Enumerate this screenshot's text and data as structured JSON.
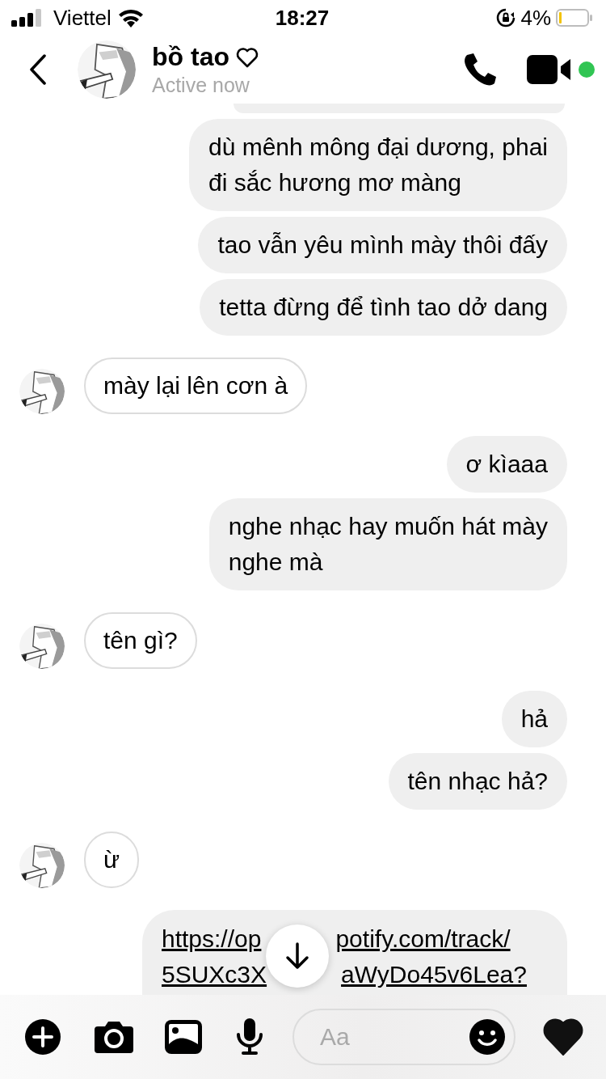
{
  "status_bar": {
    "carrier": "Viettel",
    "time": "18:27",
    "battery": "4%"
  },
  "header": {
    "name": "bồ tao",
    "status": "Active now"
  },
  "messages": [
    {
      "outgoing": true,
      "kind": "fragment"
    },
    {
      "outgoing": true,
      "kind": "text",
      "lines": [
        "dù mênh mông đại dương, phai",
        "đi sắc hương mơ màng"
      ]
    },
    {
      "outgoing": true,
      "kind": "text",
      "lines": [
        "tao vẫn yêu mình mày thôi đấy"
      ]
    },
    {
      "outgoing": true,
      "kind": "text",
      "lines": [
        "tetta đừng để tình tao dở dang"
      ]
    },
    {
      "outgoing": false,
      "kind": "text",
      "lines": [
        "mày lại lên cơn à"
      ]
    },
    {
      "outgoing": true,
      "kind": "text",
      "lines": [
        "ơ kìaaa"
      ]
    },
    {
      "outgoing": true,
      "kind": "text",
      "lines": [
        "nghe nhạc hay muốn hát mày",
        "nghe mà"
      ]
    },
    {
      "outgoing": false,
      "kind": "text",
      "lines": [
        "tên gì?"
      ]
    },
    {
      "outgoing": true,
      "kind": "text",
      "lines": [
        "hả"
      ]
    },
    {
      "outgoing": true,
      "kind": "text",
      "lines": [
        "tên nhạc hả?"
      ]
    },
    {
      "outgoing": false,
      "kind": "text",
      "lines": [
        "ừ"
      ]
    },
    {
      "outgoing": true,
      "kind": "link",
      "link_lines": [
        [
          "https://op",
          "potify.com/track/"
        ],
        [
          "5SUXc3X",
          "aWyDo45v6Lea?"
        ]
      ]
    }
  ],
  "composer": {
    "placeholder": "Aa"
  }
}
